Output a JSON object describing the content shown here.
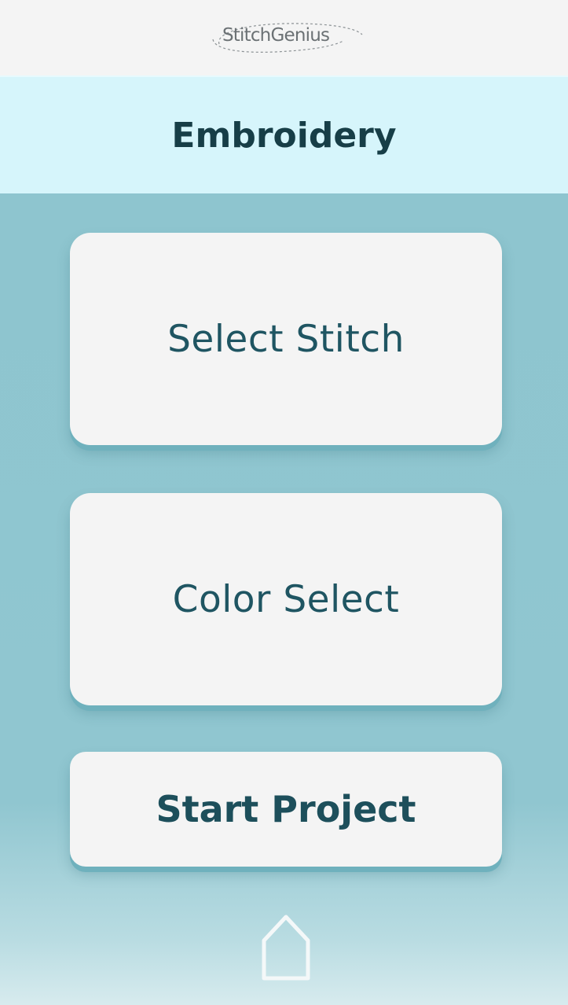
{
  "app": {
    "logo_text": "StitchGenius"
  },
  "header": {
    "title": "Embroidery"
  },
  "actions": {
    "select_stitch_label": "Select Stitch",
    "color_select_label": "Color Select",
    "start_project_label": "Start Project"
  },
  "nav": {
    "home_icon": "home-icon"
  },
  "colors": {
    "header_bg": "#d6f5fb",
    "main_bg": "#8ec5cf",
    "card_bg": "#f4f4f4",
    "text_dark": "#173e47",
    "text_teal": "#1f5562"
  }
}
